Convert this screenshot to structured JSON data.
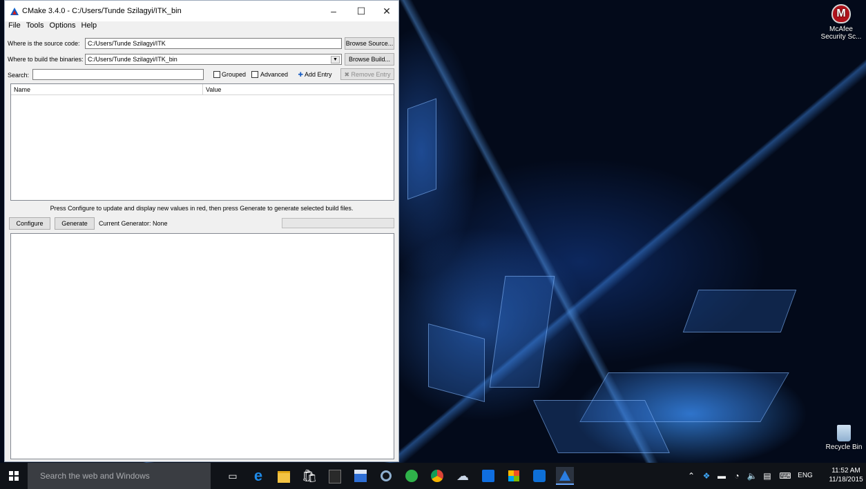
{
  "window": {
    "title": "CMake 3.4.0 - C:/Users/Tunde Szilagyi/ITK_bin",
    "controls": {
      "minimize": "–",
      "maximize": "☐",
      "close": "✕"
    }
  },
  "menu": [
    "File",
    "Tools",
    "Options",
    "Help"
  ],
  "source": {
    "label": "Where is the source code:",
    "value": "C:/Users/Tunde Szilagyi/ITK",
    "button": "Browse Source..."
  },
  "build": {
    "label": "Where to build the binaries:",
    "value": "C:/Users/Tunde Szilagyi/ITK_bin",
    "button": "Browse Build..."
  },
  "search": {
    "label": "Search:",
    "value": ""
  },
  "options": {
    "grouped": "Grouped",
    "advanced": "Advanced",
    "add_entry": "Add Entry",
    "remove_entry": "Remove Entry"
  },
  "table": {
    "columns": [
      "Name",
      "Value"
    ],
    "rows": []
  },
  "hint": "Press Configure to update and display new values in red, then press Generate to generate selected build files.",
  "actions": {
    "configure": "Configure",
    "generate": "Generate",
    "generator": "Current Generator: None"
  },
  "output_text": "",
  "desktop": {
    "icons": [
      {
        "name": "McAfee Security Sc...",
        "icon": "mcafee-icon"
      },
      {
        "name": "Recycle Bin",
        "icon": "recycle-bin-icon"
      }
    ]
  },
  "taskbar": {
    "search_placeholder": "Search the web and Windows",
    "apps": [
      "task-view",
      "edge",
      "file-explorer",
      "store",
      "kindle",
      "save-disk",
      "cortana-app",
      "green-app",
      "chrome",
      "photos",
      "dropbox",
      "windows-app",
      "teamviewer",
      "cmake"
    ],
    "tray": {
      "language": "ENG",
      "time": "11:52 AM",
      "date": "11/18/2015"
    }
  },
  "colors": {
    "accent": "#0d5fc8",
    "taskbar": "#101318",
    "window_bg": "#f0f0f0"
  }
}
